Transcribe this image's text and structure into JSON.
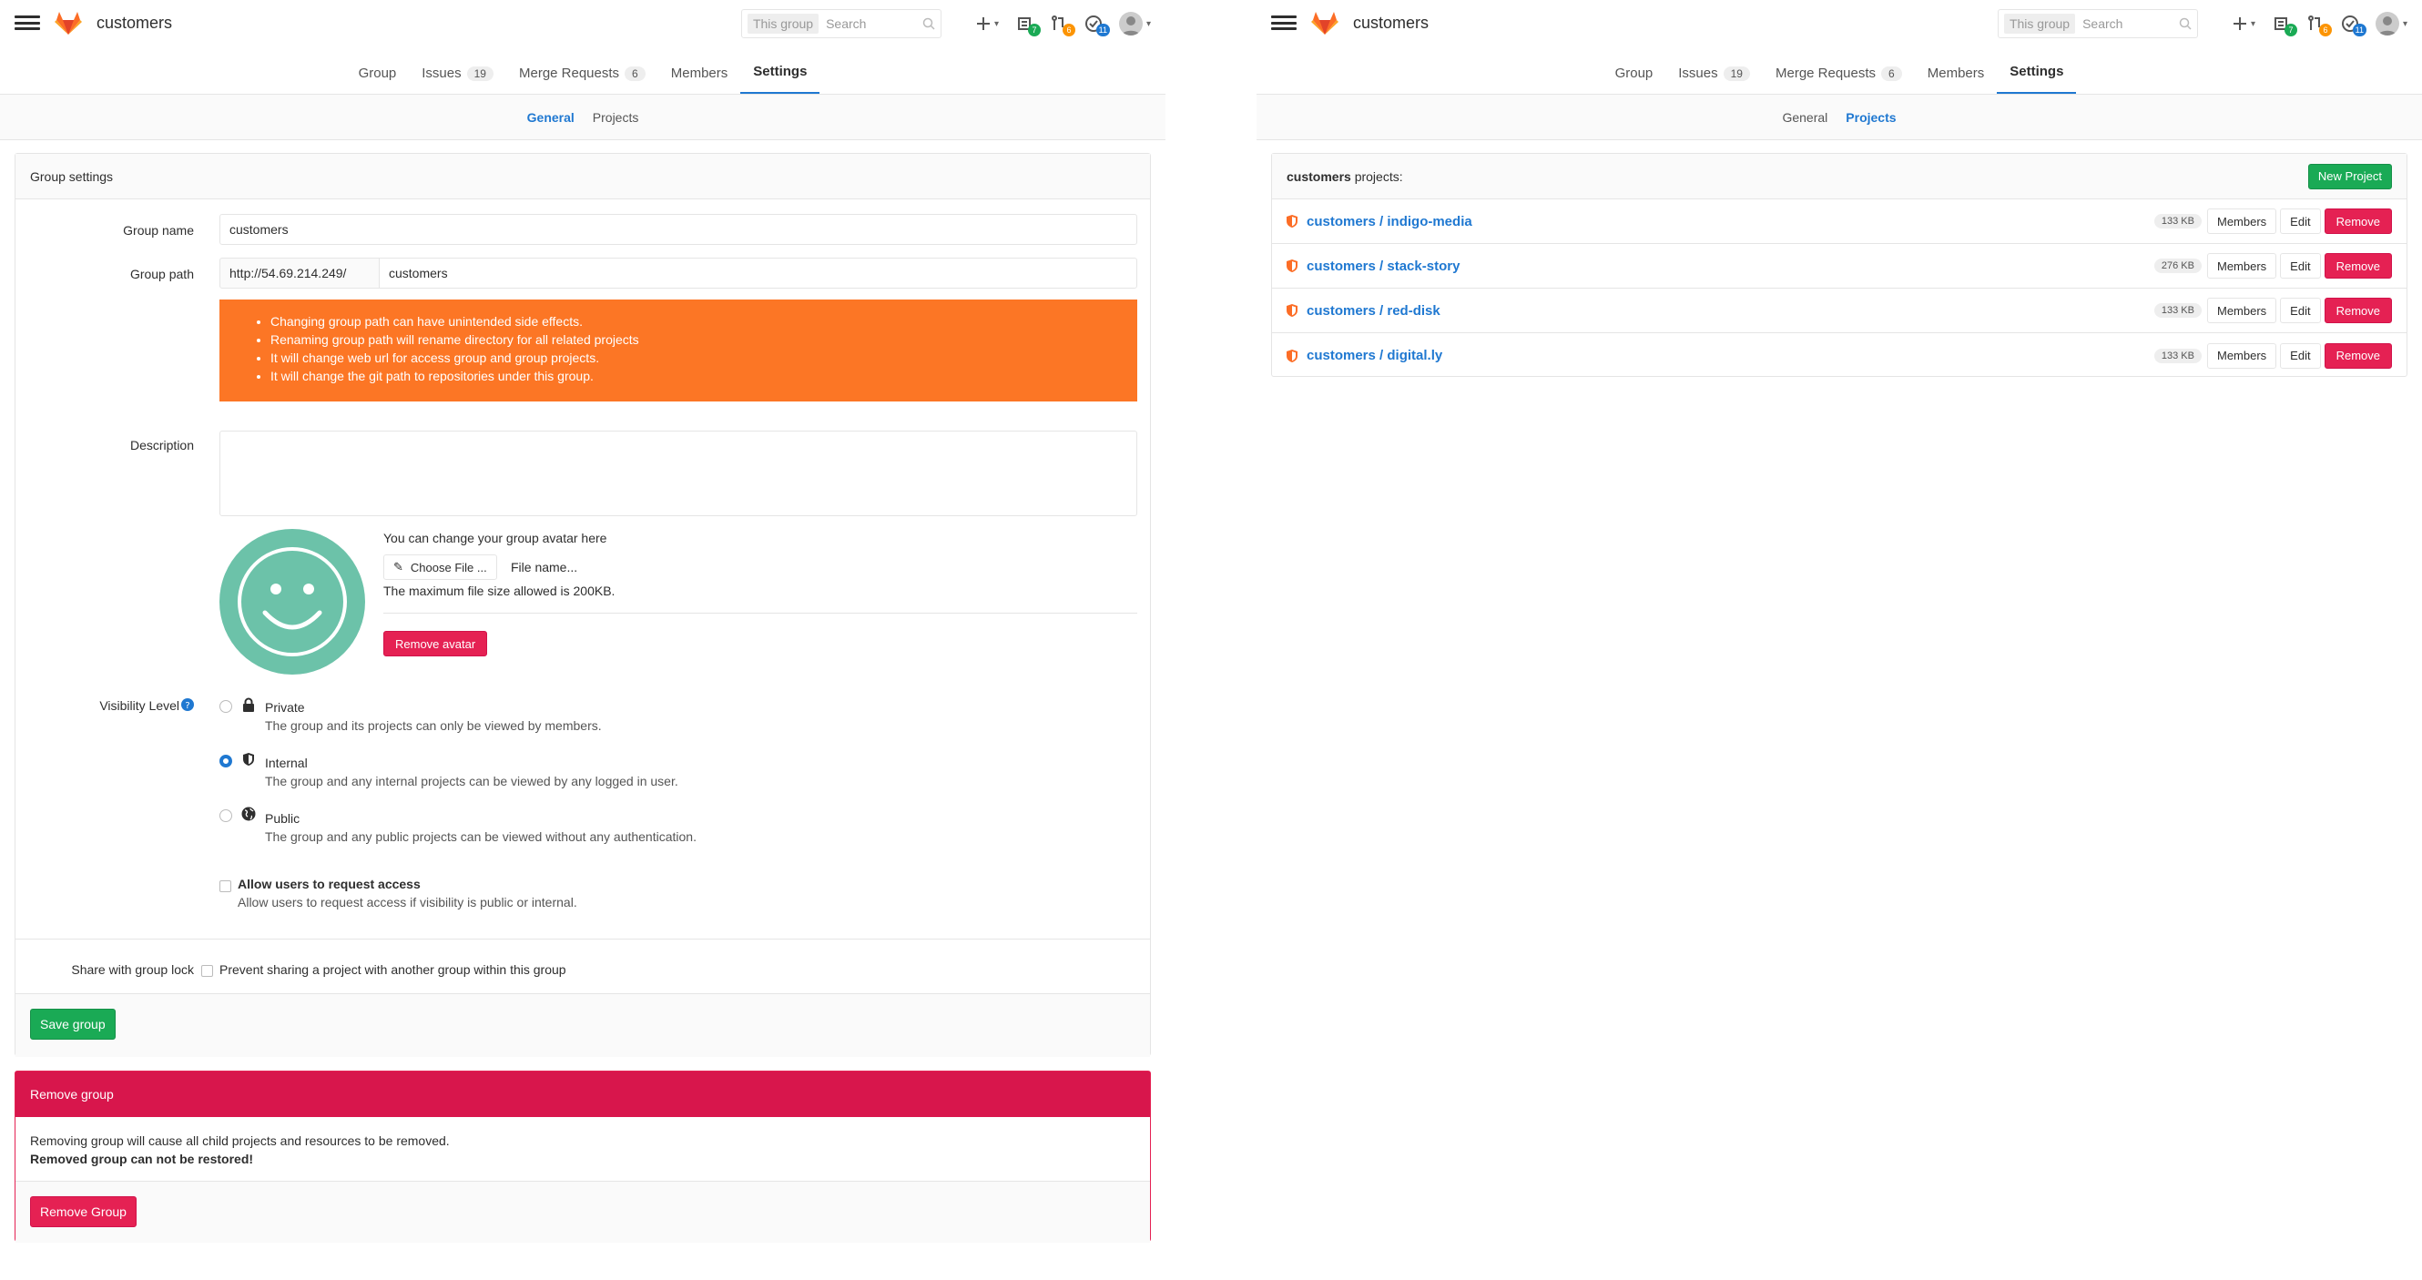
{
  "left": {
    "header": {
      "title": "customers",
      "search_scope": "This group",
      "search_placeholder": "Search",
      "todos_count": "7",
      "mr_count": "6",
      "issues_count": "11"
    },
    "nav": {
      "tabs": [
        {
          "label": "Group"
        },
        {
          "label": "Issues",
          "count": "19"
        },
        {
          "label": "Merge Requests",
          "count": "6"
        },
        {
          "label": "Members"
        },
        {
          "label": "Settings"
        }
      ]
    },
    "subnav": {
      "general": "General",
      "projects": "Projects"
    },
    "settings": {
      "panel_title": "Group settings",
      "group_name_label": "Group name",
      "group_name_value": "customers",
      "group_path_label": "Group path",
      "group_path_prefix": "http://54.69.214.249/",
      "group_path_value": "customers",
      "warnings": [
        "Changing group path can have unintended side effects.",
        "Renaming group path will rename directory for all related projects",
        "It will change web url for access group and group projects.",
        "It will change the git path to repositories under this group."
      ],
      "description_label": "Description",
      "avatar_hint": "You can change your group avatar here",
      "choose_file": "Choose File ...",
      "file_name": "File name...",
      "max_size": "The maximum file size allowed is 200KB.",
      "remove_avatar": "Remove avatar",
      "visibility_label": "Visibility Level",
      "visibility": [
        {
          "title": "Private",
          "desc": "The group and its projects can only be viewed by members."
        },
        {
          "title": "Internal",
          "desc": "The group and any internal projects can be viewed by any logged in user."
        },
        {
          "title": "Public",
          "desc": "The group and any public projects can be viewed without any authentication."
        }
      ],
      "request_access_title": "Allow users to request access",
      "request_access_desc": "Allow users to request access if visibility is public or internal.",
      "share_lock_label": "Share with group lock",
      "share_lock_desc": "Prevent sharing a project with another group within this group",
      "save_button": "Save group"
    },
    "remove": {
      "title": "Remove group",
      "line1": "Removing group will cause all child projects and resources to be removed.",
      "line2": "Removed group can not be restored!",
      "button": "Remove Group"
    }
  },
  "right": {
    "header": {
      "title": "customers",
      "search_scope": "This group",
      "search_placeholder": "Search",
      "todos_count": "7",
      "mr_count": "6",
      "issues_count": "11"
    },
    "nav": {
      "tabs": [
        {
          "label": "Group"
        },
        {
          "label": "Issues",
          "count": "19"
        },
        {
          "label": "Merge Requests",
          "count": "6"
        },
        {
          "label": "Members"
        },
        {
          "label": "Settings"
        }
      ]
    },
    "subnav": {
      "general": "General",
      "projects": "Projects"
    },
    "projects_title_bold": "customers",
    "projects_title_rest": " projects:",
    "new_project": "New Project",
    "projects": [
      {
        "name": "customers / indigo-media",
        "size": "133 KB"
      },
      {
        "name": "customers / stack-story",
        "size": "276 KB"
      },
      {
        "name": "customers / red-disk",
        "size": "133 KB"
      },
      {
        "name": "customers / digital.ly",
        "size": "133 KB"
      }
    ],
    "members_btn": "Members",
    "edit_btn": "Edit",
    "remove_btn": "Remove"
  },
  "colors": {
    "accent": "#1f78d1",
    "green": "#1aaa55",
    "red": "#e52153",
    "warning": "#fc7625",
    "avatar": "#6cc2a9"
  }
}
